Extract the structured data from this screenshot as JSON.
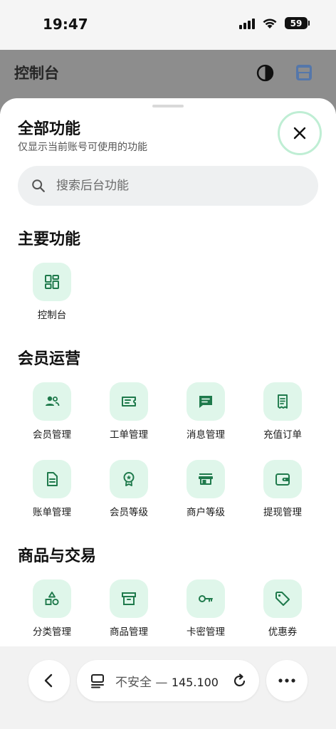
{
  "status_bar": {
    "time": "19:47",
    "battery": "59"
  },
  "app_header": {
    "title": "控制台"
  },
  "sheet": {
    "title": "全部功能",
    "subtitle": "仅显示当前账号可使用的功能",
    "search_placeholder": "搜索后台功能"
  },
  "sections": [
    {
      "title": "主要功能",
      "items": [
        {
          "label": "控制台",
          "icon": "dashboard-icon"
        }
      ]
    },
    {
      "title": "会员运营",
      "items": [
        {
          "label": "会员管理",
          "icon": "members-icon"
        },
        {
          "label": "工单管理",
          "icon": "ticket-icon"
        },
        {
          "label": "消息管理",
          "icon": "message-icon"
        },
        {
          "label": "充值订单",
          "icon": "receipt-icon"
        },
        {
          "label": "账单管理",
          "icon": "bill-icon"
        },
        {
          "label": "会员等级",
          "icon": "badge-icon"
        },
        {
          "label": "商户等级",
          "icon": "store-icon"
        },
        {
          "label": "提现管理",
          "icon": "wallet-icon"
        }
      ]
    },
    {
      "title": "商品与交易",
      "items": [
        {
          "label": "分类管理",
          "icon": "category-icon"
        },
        {
          "label": "商品管理",
          "icon": "archive-icon"
        },
        {
          "label": "卡密管理",
          "icon": "key-icon"
        },
        {
          "label": "优惠券",
          "icon": "tag-icon"
        }
      ]
    }
  ],
  "browser_bar": {
    "security": "不安全",
    "separator": "—",
    "host": "145.100"
  },
  "colors": {
    "accent": "#1f7a4c",
    "tile_bg": "#dff6ea",
    "close_ring": "#bfeed4"
  }
}
